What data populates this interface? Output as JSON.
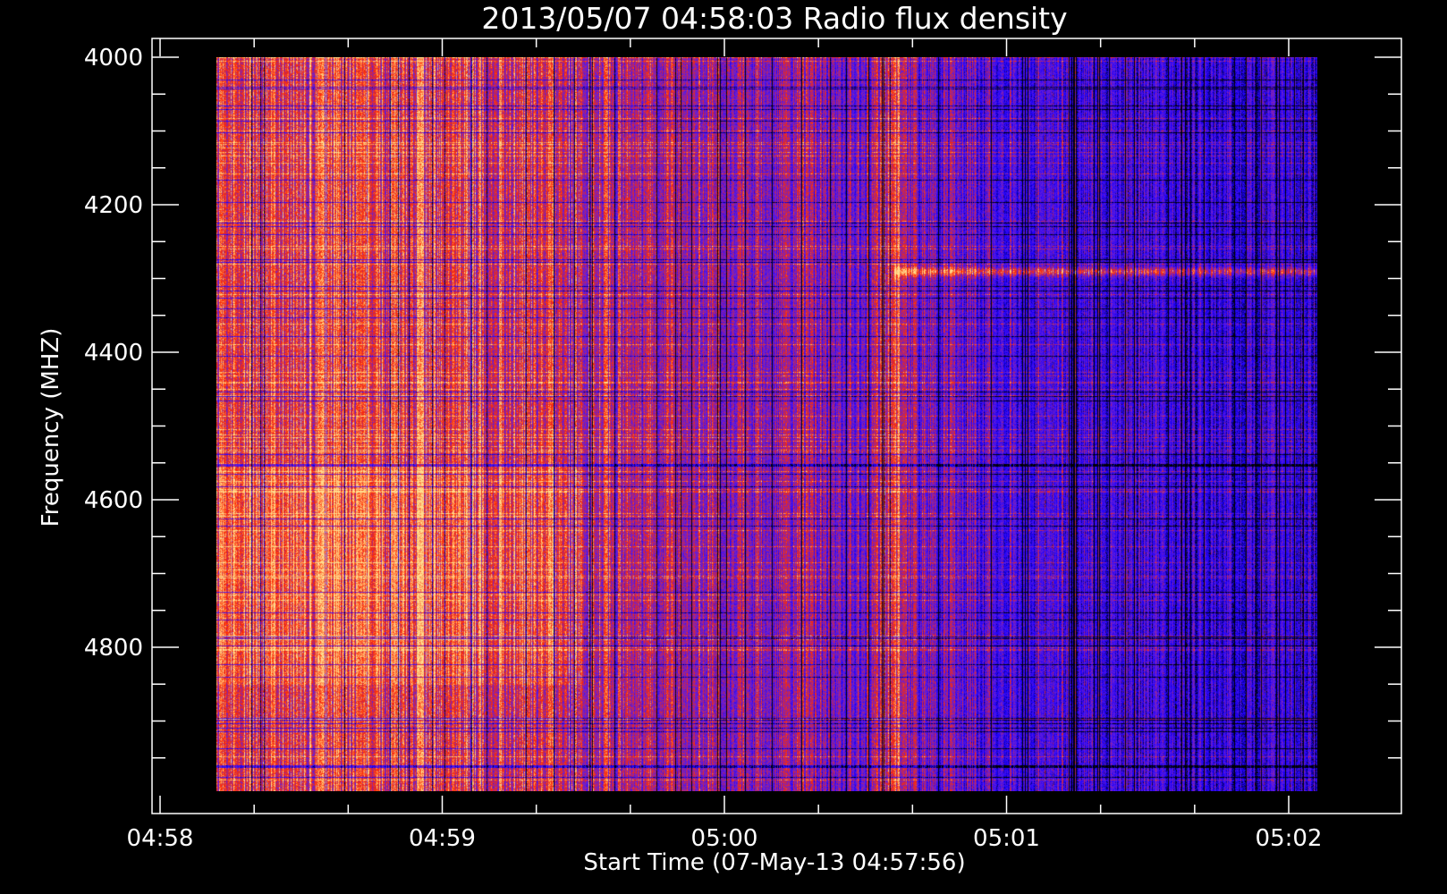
{
  "chart_data": {
    "type": "heatmap",
    "title": "2013/05/07 04:58:03 Radio flux density",
    "xlabel": "Start Time (07-May-13 04:57:56)",
    "ylabel": "Frequency (MHZ)",
    "x_ticks": [
      "04:58",
      "04:59",
      "05:00",
      "05:01",
      "05:02"
    ],
    "y_ticks": [
      "4000",
      "4200",
      "4400",
      "4600",
      "4800"
    ],
    "xlim_minutes_after_0458": [
      0,
      4.0
    ],
    "ylim": [
      4000,
      5000
    ],
    "data_time_range_minutes_after_0458": [
      0.2,
      4.1
    ],
    "data_freq_range": [
      4000,
      4995
    ],
    "colormap": [
      "#000000",
      "#1a00ff",
      "#6a1fd6",
      "#ff2a00",
      "#ffe090"
    ],
    "features": {
      "strong_emission_until_minute": 1.0,
      "emission_burst_minute": 2.6,
      "drifting_band_freq": 4290
    }
  }
}
